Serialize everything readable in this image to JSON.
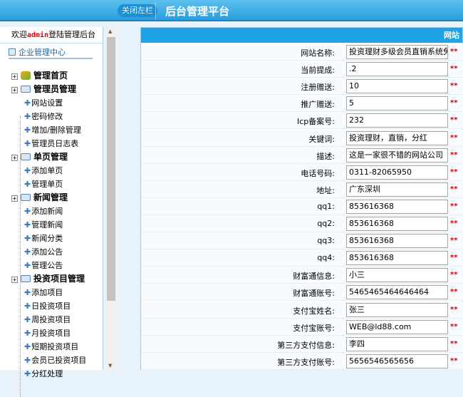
{
  "header": {
    "close_left": "关闭左栏",
    "title": "后台管理平台"
  },
  "sidebar": {
    "welcome_prefix": "欢迎",
    "user": "admin",
    "welcome_suffix": "登陆管理后台",
    "center": "企业管理中心",
    "groups": [
      {
        "label": "管理首页",
        "icon": "home-icon",
        "items": []
      },
      {
        "label": "管理员管理",
        "icon": "folder-icon",
        "items": [
          "网站设置",
          "密码修改",
          "增加/删除管理",
          "管理员日志表"
        ]
      },
      {
        "label": "单页管理",
        "icon": "folder-icon",
        "items": [
          "添加单页",
          "管理单页"
        ]
      },
      {
        "label": "新闻管理",
        "icon": "folder-icon",
        "items": [
          "添加新闻",
          "管理新闻",
          "新闻分类",
          "添加公告",
          "管理公告"
        ]
      },
      {
        "label": "投资项目管理",
        "icon": "folder-icon",
        "items": [
          "添加项目",
          "日投资项目",
          "周投资项目",
          "月投资项目",
          "短期投资项目",
          "会员已投资项目",
          "分红处理"
        ]
      }
    ]
  },
  "main": {
    "header": "网站",
    "required_mark": "**",
    "fields": [
      {
        "label": "网站名称:",
        "value": "投资理财多级会员直销系统免费"
      },
      {
        "label": "当前提成:",
        "value": ".2"
      },
      {
        "label": "注册赠送:",
        "value": "10"
      },
      {
        "label": "推广赠送:",
        "value": "5"
      },
      {
        "label": "Icp备案号:",
        "value": "232"
      },
      {
        "label": "关键词:",
        "value": "投资理财，直销，分红"
      },
      {
        "label": "描述:",
        "value": "这是一家很不错的网站公司"
      },
      {
        "label": "电话号码:",
        "value": "0311-82065950"
      },
      {
        "label": "地址:",
        "value": "广东深圳"
      },
      {
        "label": "qq1:",
        "value": "853616368"
      },
      {
        "label": "qq2:",
        "value": "853616368"
      },
      {
        "label": "qq3:",
        "value": "853616368"
      },
      {
        "label": "qq4:",
        "value": "853616368"
      },
      {
        "label": "财富通信息:",
        "value": "小三"
      },
      {
        "label": "财富通账号:",
        "value": "5465465464646464"
      },
      {
        "label": "支付宝姓名:",
        "value": "张三"
      },
      {
        "label": "支付宝账号:",
        "value": "WEB@ld88.com"
      },
      {
        "label": "第三方支付信息:",
        "value": "李四"
      },
      {
        "label": "第三方支付账号:",
        "value": "5656546565656"
      }
    ]
  }
}
